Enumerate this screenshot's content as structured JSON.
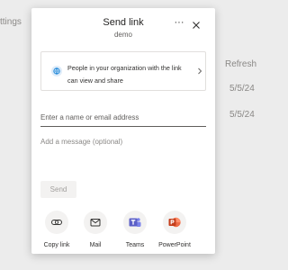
{
  "background": {
    "settings_label": "ttings",
    "refresh_header": "Refresh",
    "dates": [
      "5/5/24",
      "5/5/24"
    ]
  },
  "dialog": {
    "title": "Send link",
    "subtitle": "demo",
    "more_icon": "more-icon",
    "close_icon": "close-icon",
    "permission": {
      "icon": "globe-icon",
      "text": "People in your organization with the link can view and share"
    },
    "recipient_placeholder": "Enter a name or email address",
    "message_placeholder": "Add a message (optional)",
    "send_label": "Send",
    "share_options": [
      {
        "label": "Copy link",
        "icon": "link-icon"
      },
      {
        "label": "Mail",
        "icon": "mail-icon"
      },
      {
        "label": "Teams",
        "icon": "teams-icon"
      },
      {
        "label": "PowerPoint",
        "icon": "powerpoint-icon"
      }
    ],
    "colors": {
      "teams": "#5b5fc7",
      "powerpoint": "#c43e1c",
      "accent": "#0078d4"
    }
  }
}
